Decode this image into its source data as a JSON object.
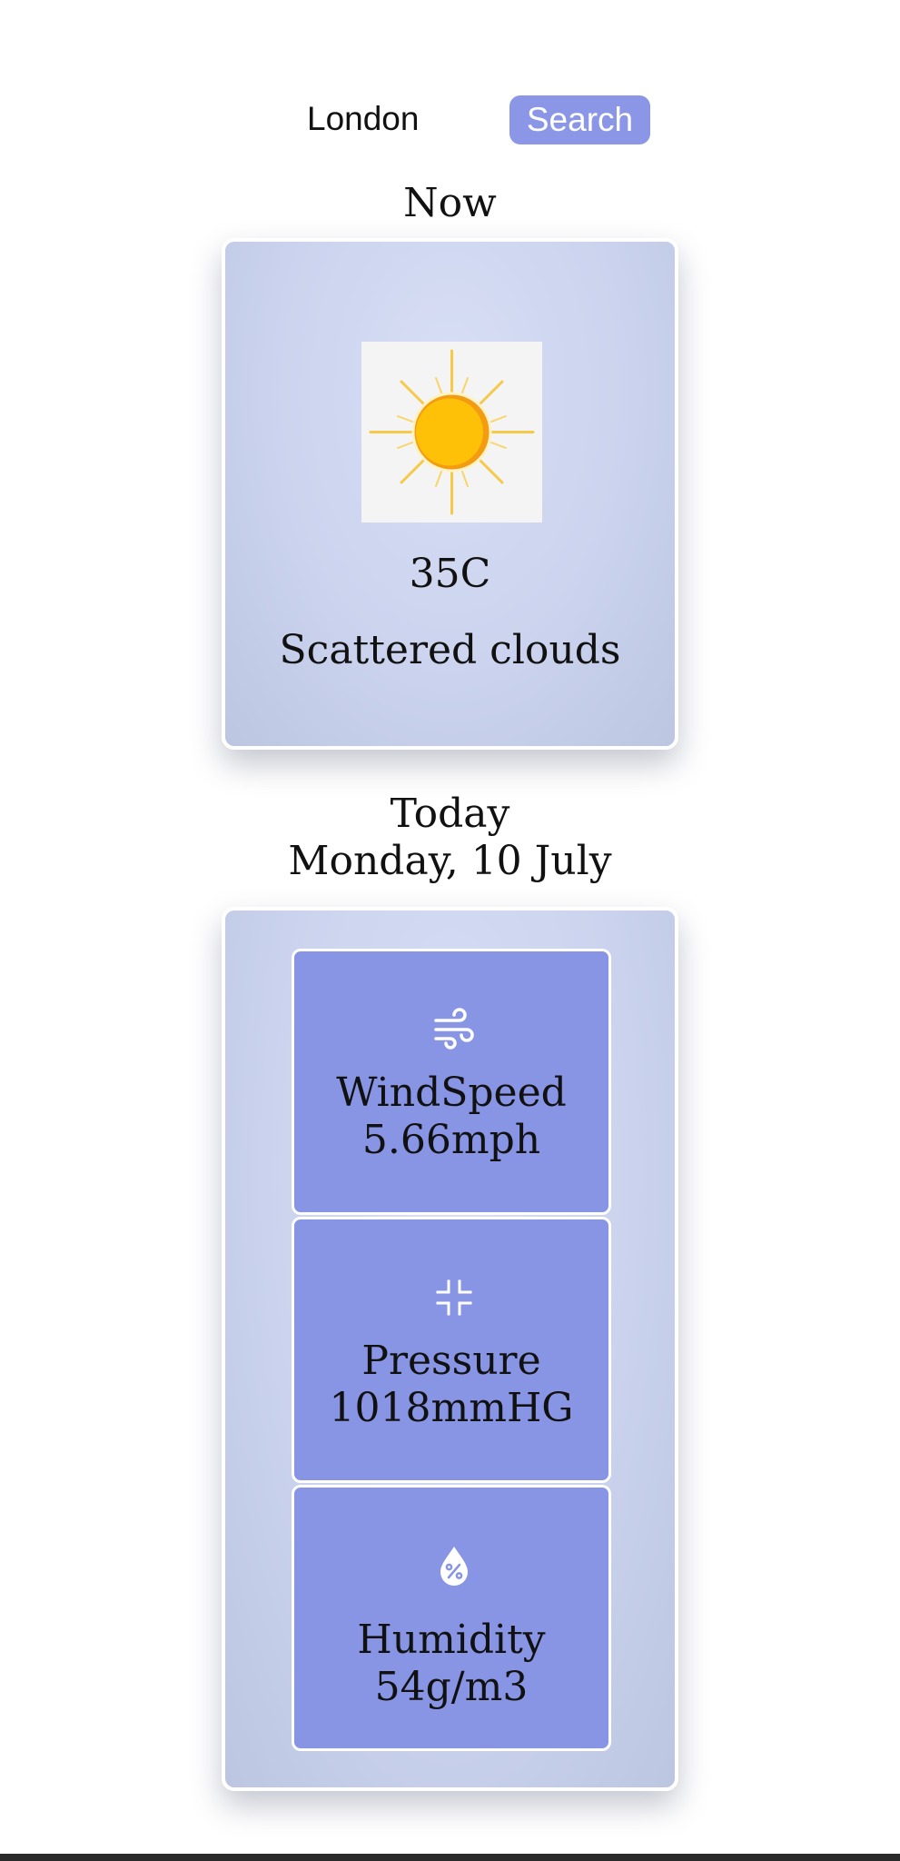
{
  "search": {
    "input_value": "London",
    "button_label": "Search"
  },
  "now": {
    "title": "Now",
    "icon": "sun-icon",
    "temperature": "35C",
    "description": "Scattered clouds"
  },
  "today": {
    "title": "Today",
    "date": "Monday, 10 July",
    "stats": [
      {
        "icon": "wind-icon",
        "label": "WindSpeed",
        "value": "5.66mph"
      },
      {
        "icon": "pressure-icon",
        "label": "Pressure",
        "value": "1018mmHG"
      },
      {
        "icon": "humidity-icon",
        "label": "Humidity",
        "value": "54g/m3"
      }
    ]
  },
  "colors": {
    "accent": "#8b97e6",
    "tile": "#8795e4",
    "card": "#cbd3ee",
    "sun": "#ffc107",
    "sun_ring": "#f39c12"
  }
}
